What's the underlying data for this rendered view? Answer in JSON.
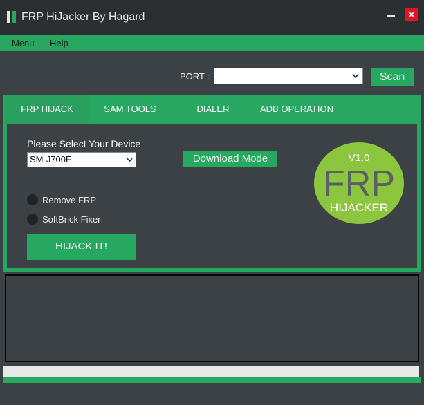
{
  "window": {
    "title": "FRP HiJacker By Hagard",
    "close_symbol": "✕"
  },
  "menu": {
    "items": [
      {
        "label": "Menu"
      },
      {
        "label": "Help"
      }
    ]
  },
  "port": {
    "label": "PORT :",
    "value": "",
    "scan_label": "Scan"
  },
  "tabs": [
    {
      "label": "FRP HIJACK",
      "active": true
    },
    {
      "label": "SAM TOOLS",
      "active": false
    },
    {
      "label": "DIALER",
      "active": false
    },
    {
      "label": "ADB OPERATION",
      "active": false
    }
  ],
  "frp_panel": {
    "device_label": "Please Select Your Device",
    "device_selected": "SM-J700F",
    "download_mode_label": "Download Mode",
    "options": [
      {
        "label": "Remove FRP"
      },
      {
        "label": "SoftBrick Fixer"
      }
    ],
    "hijack_label": "HIJACK IT!"
  },
  "logo": {
    "version": "V1.0",
    "big": "FRP",
    "sub": "HIJACKER"
  },
  "colors": {
    "accent": "#27a860",
    "background": "#3b4144",
    "titlebar": "#2b2f31",
    "close": "#e81123",
    "logo_green": "#8cc63f"
  }
}
